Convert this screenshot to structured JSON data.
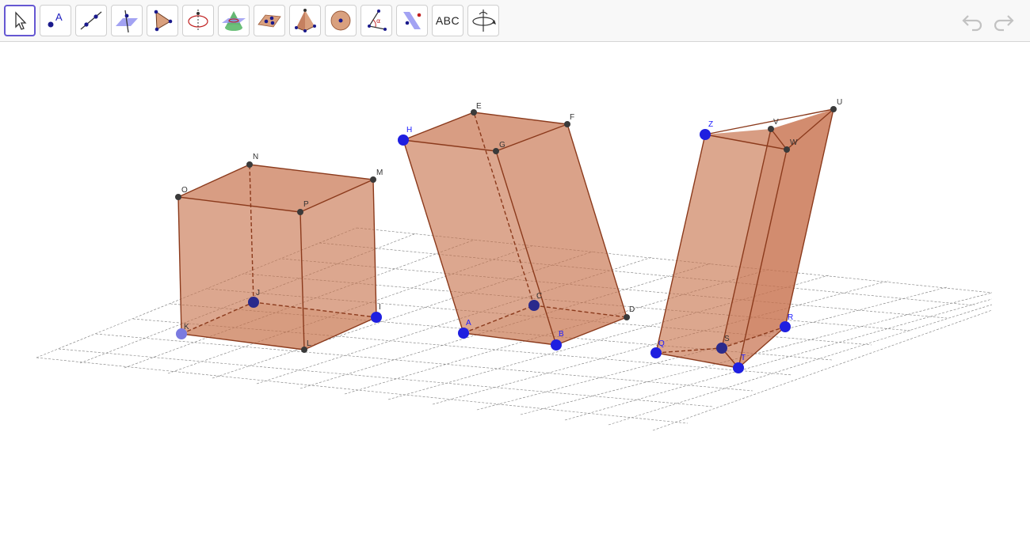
{
  "toolbar": {
    "tools": [
      {
        "name": "move-tool",
        "icon": "cursor-arrow-icon",
        "active": true
      },
      {
        "name": "point-tool",
        "icon": "point-a-icon"
      },
      {
        "name": "line-tool",
        "icon": "line-through-points-icon"
      },
      {
        "name": "perpendicular-line-tool",
        "icon": "perpendicular-plane-icon"
      },
      {
        "name": "polygon-tool",
        "icon": "triangle-icon"
      },
      {
        "name": "circle-axis-tool",
        "icon": "circle-axis-icon"
      },
      {
        "name": "intersect-surfaces-tool",
        "icon": "cone-plane-icon"
      },
      {
        "name": "plane-tool",
        "icon": "plane-points-icon"
      },
      {
        "name": "pyramid-tool",
        "icon": "pyramid-icon"
      },
      {
        "name": "sphere-tool",
        "icon": "sphere-icon"
      },
      {
        "name": "angle-tool",
        "icon": "angle-icon"
      },
      {
        "name": "reflect-tool",
        "icon": "reflect-plane-icon"
      },
      {
        "name": "text-tool",
        "icon": "text-icon",
        "label": "ABC"
      },
      {
        "name": "rotate-view-tool",
        "icon": "rotate-view-icon"
      }
    ],
    "undo_icon": "undo-icon",
    "redo_icon": "redo-icon"
  },
  "colors": {
    "face_fill": "#c6704a",
    "edge": "#8b3a1c",
    "free_point": "#1f1fe0",
    "dependent_point": "#3a3a3a",
    "grid": "#7a7a7a",
    "accent": "#6557d2"
  },
  "scene": {
    "solids": [
      {
        "name": "cube-solid",
        "kind": "cube"
      },
      {
        "name": "oblique-prism-solid",
        "kind": "oblique-parallelepiped"
      },
      {
        "name": "triangular-prism-solid",
        "kind": "triangular-prism"
      }
    ],
    "points": {
      "K": "K",
      "L": "L",
      "I": "I",
      "J": "J",
      "O": "O",
      "P": "P",
      "M": "M",
      "N": "N",
      "A": "A",
      "B": "B",
      "C": "C",
      "D": "D",
      "E": "E",
      "F": "F",
      "G": "G",
      "H": "H",
      "Q": "Q",
      "R": "R",
      "S": "S",
      "T": "T",
      "U": "U",
      "V": "V",
      "W": "W",
      "Z": "Z"
    }
  }
}
